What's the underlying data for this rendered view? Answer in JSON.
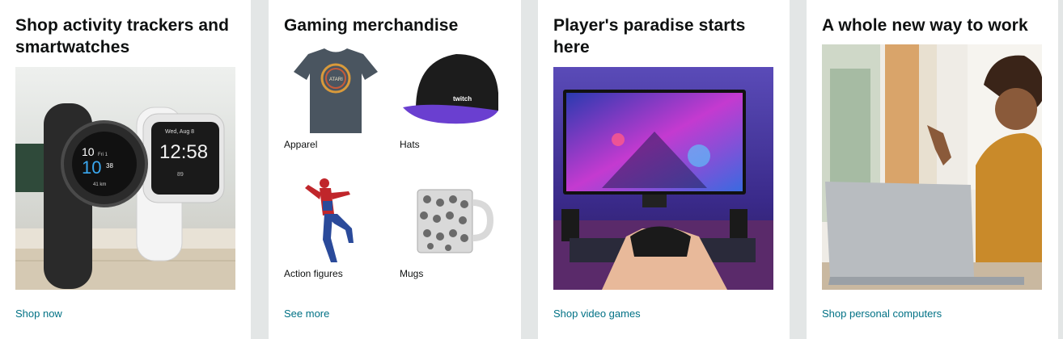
{
  "cards": [
    {
      "title": "Shop activity trackers and smartwatches",
      "link": "Shop now",
      "image": {
        "icon": "smartwatches-image",
        "watch1": {
          "line1": "10",
          "line1b": "Fri 1",
          "line2": "10",
          "line2b": "38",
          "line3": "41 km"
        },
        "watch2": {
          "date": "Wed, Aug 8",
          "time": "12:58",
          "stat": "89"
        }
      }
    },
    {
      "title": "Gaming merchandise",
      "link": "See more",
      "items": [
        {
          "label": "Apparel",
          "icon": "atari-tshirt-image",
          "print": "ATARI"
        },
        {
          "label": "Hats",
          "icon": "twitch-cap-image",
          "print": "twitch"
        },
        {
          "label": "Action figures",
          "icon": "spiderman-figure-image"
        },
        {
          "label": "Mugs",
          "icon": "mug-image"
        }
      ]
    },
    {
      "title": "Player's paradise starts here",
      "link": "Shop video games",
      "image": {
        "icon": "gaming-setup-image"
      }
    },
    {
      "title": "A whole new way to work",
      "link": "Shop personal computers",
      "image": {
        "icon": "woman-laptop-image"
      }
    }
  ],
  "colors": {
    "background": "#e3e6e6",
    "link": "#007185",
    "title": "#0f1111"
  }
}
